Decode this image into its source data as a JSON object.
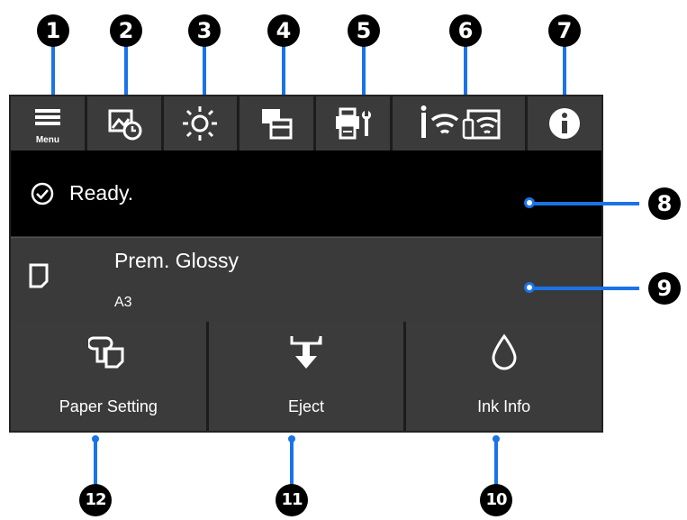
{
  "callouts": [
    "1",
    "2",
    "3",
    "4",
    "5",
    "6",
    "7",
    "8",
    "9",
    "10",
    "11",
    "12"
  ],
  "icon_bar": {
    "menu_label": "Menu",
    "icons": [
      "menu-icon",
      "maintenance-schedule-icon",
      "brightness-icon",
      "job-queue-icon",
      "printer-settings-icon",
      "network-status-icon",
      "information-icon"
    ]
  },
  "status": {
    "icon": "check-circle-icon",
    "text": "Ready."
  },
  "paper": {
    "icon": "paper-sheet-icon",
    "type": "Prem. Glossy",
    "size": "A3"
  },
  "buttons": [
    {
      "icon": "paper-setting-icon",
      "label": "Paper Setting"
    },
    {
      "icon": "eject-icon",
      "label": "Eject"
    },
    {
      "icon": "ink-drop-icon",
      "label": "Ink Info"
    }
  ],
  "colors": {
    "callout_line": "#1a73e8",
    "panel_bg": "#2b2b2b",
    "status_bg": "#000000"
  }
}
